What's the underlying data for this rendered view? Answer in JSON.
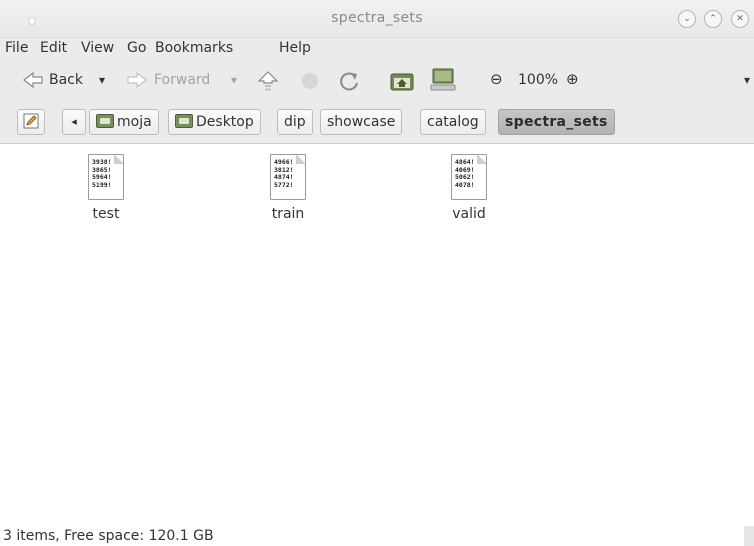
{
  "window": {
    "title": "spectra_sets",
    "controls": {
      "minimize": "⌄",
      "maximize": "⌃",
      "close": "✕"
    }
  },
  "menubar": {
    "items": [
      "File",
      "Edit",
      "View",
      "Go",
      "Bookmarks",
      "Help"
    ]
  },
  "toolbar": {
    "back_label": "Back",
    "back_arrow": "▾",
    "forward_label": "Forward",
    "forward_arrow": "▾",
    "zoom_out": "⊖",
    "zoom_level": "100%",
    "zoom_in": "⊕",
    "overflow": "▾"
  },
  "pathbar": {
    "nav_left": "◂",
    "crumbs": [
      {
        "label": "moja",
        "icon": "home-folder-icon"
      },
      {
        "label": "Desktop",
        "icon": "desktop-folder-icon"
      },
      {
        "label": "dip"
      },
      {
        "label": "showcase"
      },
      {
        "label": "catalog"
      },
      {
        "label": "spectra_sets",
        "active": true
      }
    ]
  },
  "files": [
    {
      "name": "test",
      "preview": [
        "3938!",
        "3865!",
        "5964!",
        "5199!"
      ]
    },
    {
      "name": "train",
      "preview": [
        "4966!",
        "3812!",
        "4874!",
        "5772!"
      ]
    },
    {
      "name": "valid",
      "preview": [
        "4864!",
        "4069!",
        "5062!",
        "4078!"
      ]
    }
  ],
  "status": {
    "text": "3 items, Free space: 120.1 GB"
  }
}
